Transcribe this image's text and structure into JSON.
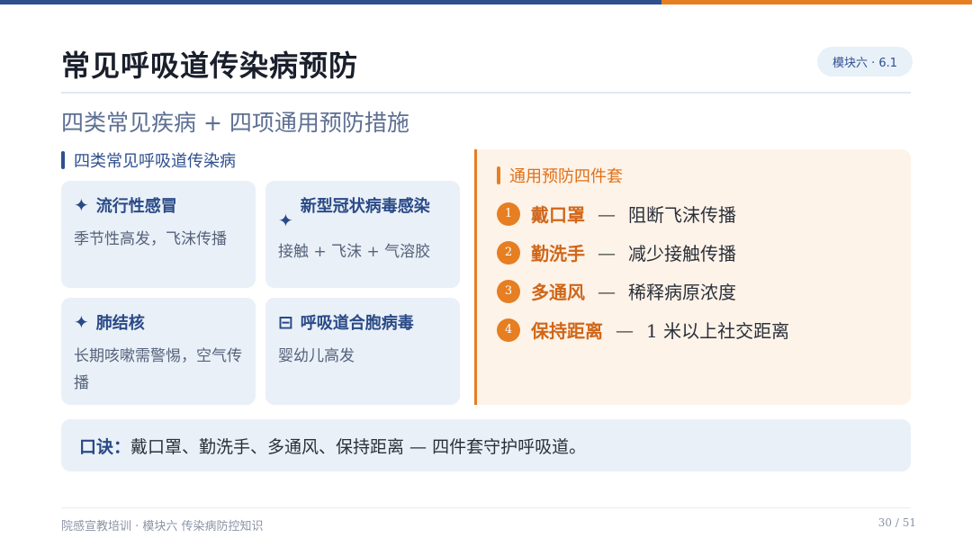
{
  "header": {
    "title": "常见呼吸道传染病预防",
    "badge": "模块六 · 6.1",
    "subtitle": "四类常见疾病 + 四项通用预防措施"
  },
  "left": {
    "heading": "四类常见呼吸道传染病",
    "cards": [
      {
        "icon": "✦",
        "title": "流行性感冒",
        "desc": "季节性高发，飞沫传播"
      },
      {
        "icon": "✦",
        "title": "新型冠状病毒感染",
        "desc": "接触 + 飞沫 + 气溶胶"
      },
      {
        "icon": "✦",
        "title": "肺结核",
        "desc": "长期咳嗽需警惕，空气传播"
      },
      {
        "icon": "⊟",
        "title": "呼吸道合胞病毒",
        "desc": "婴幼儿高发"
      }
    ]
  },
  "right": {
    "heading": "通用预防四件套",
    "items": [
      {
        "num": "1",
        "name": "戴口罩",
        "dash": "—",
        "text": "阻断飞沫传播"
      },
      {
        "num": "2",
        "name": "勤洗手",
        "dash": "—",
        "text": "减少接触传播"
      },
      {
        "num": "3",
        "name": "多通风",
        "dash": "—",
        "text": "稀释病原浓度"
      },
      {
        "num": "4",
        "name": "保持距离",
        "dash": "—",
        "text": "1 米以上社交距离"
      }
    ]
  },
  "motto": {
    "label": "口诀：",
    "text": "戴口罩、勤洗手、多通风、保持距离 — 四件套守护呼吸道。"
  },
  "footer": {
    "left": "院感宣教培训 · 模块六 传染病防控知识",
    "page": "30 / 51"
  },
  "colors": {
    "primary": "#2f4f8f",
    "accent": "#e67e22",
    "card_bg": "#e9f0f8",
    "panel_bg": "#fdf3e8"
  }
}
